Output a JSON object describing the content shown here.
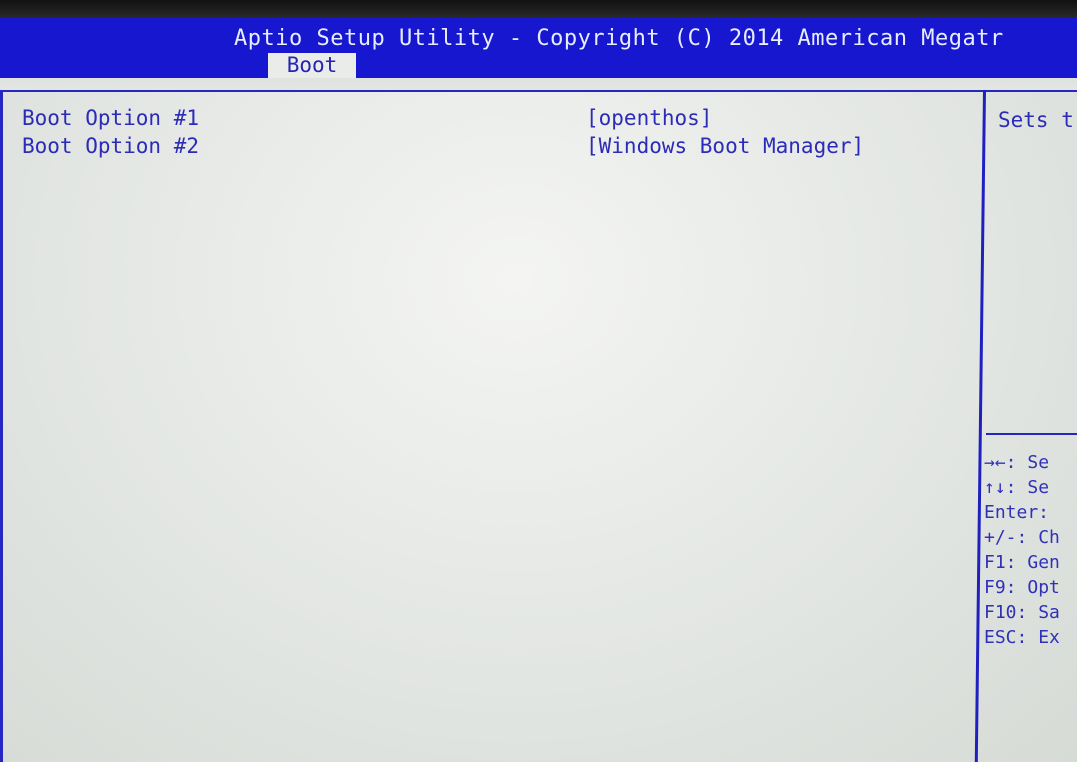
{
  "header": {
    "title": "Aptio Setup Utility - Copyright (C) 2014 American Megatr",
    "active_tab": "Boot"
  },
  "boot_options": [
    {
      "label": "Boot Option #1",
      "value": "[openthos]"
    },
    {
      "label": "Boot Option #2",
      "value": "[Windows Boot Manager]"
    }
  ],
  "help": {
    "text": "Sets t"
  },
  "key_legend": [
    {
      "keys": "→←:",
      "action": "Se",
      "icon": "arrows-left-right-icon"
    },
    {
      "keys": "↑↓:",
      "action": "Se",
      "icon": "arrows-up-down-icon"
    },
    {
      "keys": "Enter:",
      "action": ""
    },
    {
      "keys": "+/-:",
      "action": "Ch"
    },
    {
      "keys": "F1:",
      "action": "Gen"
    },
    {
      "keys": "F9:",
      "action": "Opt"
    },
    {
      "keys": "F10:",
      "action": "Sa"
    },
    {
      "keys": "ESC:",
      "action": "Ex"
    }
  ],
  "colors": {
    "header_bg": "#1717d0",
    "text": "#2b2bb8",
    "screen_bg": "#e6e9e6"
  }
}
